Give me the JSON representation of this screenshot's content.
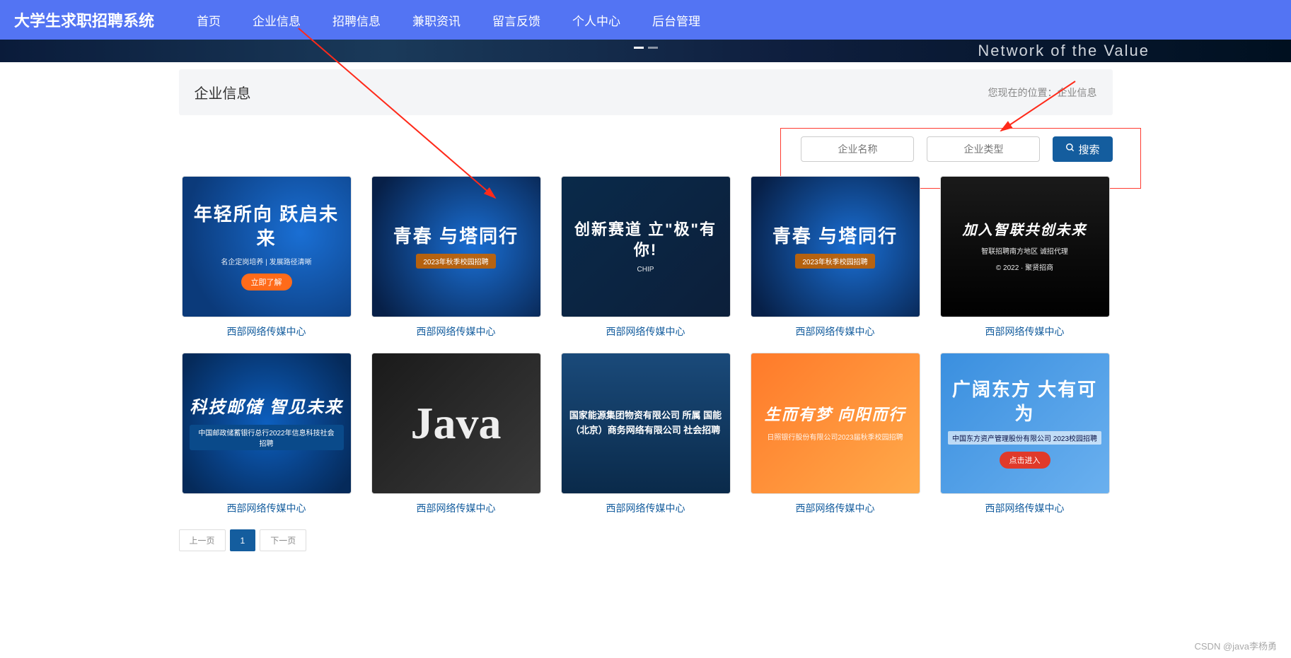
{
  "brand": "大学生求职招聘系统",
  "nav": [
    "首页",
    "企业信息",
    "招聘信息",
    "兼职资讯",
    "留言反馈",
    "个人中心",
    "后台管理"
  ],
  "hero_text": "Network of the Value",
  "page": {
    "title": "企业信息",
    "breadcrumb_prefix": "您现在的位置：",
    "breadcrumb_current": "企业信息"
  },
  "search": {
    "name_placeholder": "企业名称",
    "type_placeholder": "企业类型",
    "button": "搜索"
  },
  "items": [
    {
      "title": "西部网络传媒中心",
      "thumb_primary": "年轻所向 跃启未来",
      "thumb_sub": "名企定岗培养 | 发展路径清晰",
      "thumb_btn": "立即了解",
      "style": "bg1"
    },
    {
      "title": "西部网络传媒中心",
      "thumb_primary": "青春 与塔同行",
      "thumb_sub": "2023年秋季校园招聘",
      "thumb_btn": "",
      "style": "bg2"
    },
    {
      "title": "西部网络传媒中心",
      "thumb_primary": "创新赛道 立\"极\"有你!",
      "thumb_sub": "CHIP",
      "thumb_btn": "",
      "style": "bg3"
    },
    {
      "title": "西部网络传媒中心",
      "thumb_primary": "青春 与塔同行",
      "thumb_sub": "2023年秋季校园招聘",
      "thumb_btn": "",
      "style": "bg4"
    },
    {
      "title": "西部网络传媒中心",
      "thumb_primary": "加入智联共创未来",
      "thumb_sub": "智联招聘南方地区 诚招代理",
      "thumb_extra": "© 2022 · 聚贤招商",
      "style": "bg5"
    },
    {
      "title": "西部网络传媒中心",
      "thumb_primary": "科技邮储 智见未来",
      "thumb_sub": "中国邮政储蓄银行总行2022年信息科技社会招聘",
      "thumb_btn": "",
      "style": "bg6"
    },
    {
      "title": "西部网络传媒中心",
      "thumb_primary": "Java",
      "thumb_sub": "",
      "thumb_btn": "",
      "style": "bg7"
    },
    {
      "title": "西部网络传媒中心",
      "thumb_primary": "国家能源集团物资有限公司 所属 国能（北京）商务网络有限公司 社会招聘",
      "thumb_sub": "",
      "thumb_btn": "",
      "style": "bg8"
    },
    {
      "title": "西部网络传媒中心",
      "thumb_primary": "生而有梦 向阳而行",
      "thumb_sub": "日照银行股份有限公司2023届秋季校园招聘",
      "thumb_btn": "",
      "style": "bg9"
    },
    {
      "title": "西部网络传媒中心",
      "thumb_primary": "广阔东方 大有可为",
      "thumb_sub": "中国东方资产管理股份有限公司 2023校园招聘",
      "thumb_btn": "点击进入",
      "style": "bg10"
    }
  ],
  "pagination": {
    "prev": "上一页",
    "pages": [
      "1"
    ],
    "next": "下一页",
    "active": "1"
  },
  "watermark": "CSDN @java李杨勇"
}
